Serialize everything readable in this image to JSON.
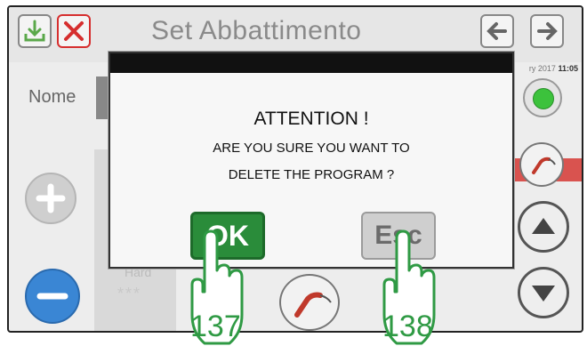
{
  "header": {
    "title": "Set Abbattimento",
    "date": "ry 2017",
    "time": "11:05"
  },
  "form": {
    "name_label": "Nome"
  },
  "left_panel": {
    "hard_label": "Hard",
    "stars": "***"
  },
  "dialog": {
    "title": "ATTENTION !",
    "line1": "ARE YOU SURE YOU WANT TO",
    "line2": "DELETE THE PROGRAM ?",
    "ok_label": "OK",
    "esc_label": "Esc"
  },
  "callouts": {
    "ok_number": "137",
    "esc_number": "138"
  },
  "icons": {
    "save": "download-icon",
    "cancel": "close-icon",
    "back": "arrow-left-icon",
    "forward": "arrow-right-icon",
    "status": "green-status-icon",
    "probe": "probe-icon",
    "up": "arrow-up-icon",
    "down": "arrow-down-icon",
    "plus": "plus-icon",
    "minus": "minus-icon"
  },
  "colors": {
    "ok_green": "#2a8c3a",
    "callout_green": "#2f9a44",
    "cancel_red": "#d62e2e",
    "minus_blue": "#3a86d4",
    "status_green": "#3cc23c"
  }
}
